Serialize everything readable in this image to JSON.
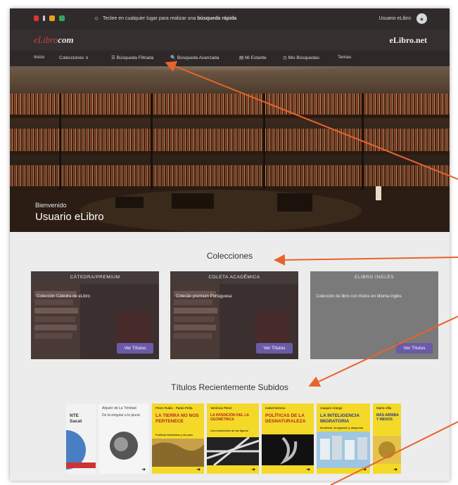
{
  "topbar": {
    "search_placeholder_pre": "Teclee en cualquier lugar para realizar una",
    "search_placeholder_bold": "búsqueda rápida",
    "user_name": "Usuario eLibro",
    "icons": [
      "flag-icon",
      "pencil-icon",
      "badge-icon",
      "card-icon"
    ]
  },
  "brand": {
    "left_logo_a": "eLibro",
    "left_logo_b": "com",
    "right_logo": "eLibro.net"
  },
  "nav": {
    "items": [
      "Inicio",
      "Colecciones ∨",
      "☰ Búsqueda Filtrada",
      "🔍 Búsqueda Avanzada",
      "▤ Mi Estante",
      "◷ Mis Búsquedas",
      "Temas"
    ]
  },
  "hero": {
    "welcome": "Bienvenido",
    "user": "Usuario eLibro"
  },
  "collections": {
    "title": "Colecciones",
    "cards": [
      {
        "head": "CÁTEDRA/PREMIUM",
        "desc": "Colección Cátedra de eLibro",
        "button": "Ver Títulos"
      },
      {
        "head": "COLETA ACADÊMICA",
        "desc": "Colecão premium Portuguesa",
        "button": "Ver Títulos"
      },
      {
        "head": "ELIBRO INGLÉS",
        "desc": "Colección de libro con títulos en idioma inglés",
        "button": "Ver Títulos"
      }
    ]
  },
  "recent": {
    "title": "Títulos Recientemente Subidos",
    "books": [
      {
        "author": "",
        "title": "NTE\nSacat",
        "sub": ""
      },
      {
        "author": "Alquier de La Trinidad",
        "title": "De la singular a lo plural",
        "sub": ""
      },
      {
        "author": "Pérez Rubio · Pardo Peña",
        "title": "LA TIERRA NO NOS PERTENECE",
        "sub": "Poéticas feministas y de paso"
      },
      {
        "author": "Verónica Pérez",
        "title": "LA INVENCIÓN DEL LA GEOMÉTRICA",
        "sub": "Una exploración de las figuras"
      },
      {
        "author": "Isabel Moreno",
        "title": "POLÍTICAS DE LA DESNATURALEZA",
        "sub": ""
      },
      {
        "author": "Joaquín Arango",
        "title": "LA INTELIGENCIA MIGRATORIA",
        "sub": "Movilidad, inmigración y diásporas"
      },
      {
        "author": "María Villa",
        "title": "MÁS ARRIBA Y MENOS",
        "sub": ""
      }
    ]
  },
  "colors": {
    "accent_button": "#6a5aa8",
    "annotation_arrow": "#e8632b",
    "topbar": "#2f2b2b",
    "book_yellow": "#f4d928"
  }
}
